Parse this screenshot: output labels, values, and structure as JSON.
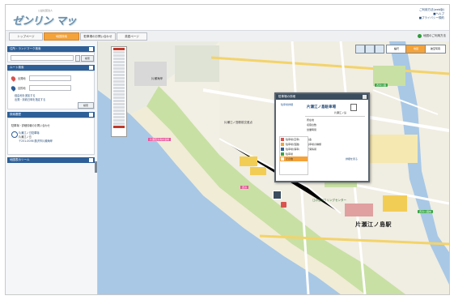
{
  "header": {
    "logo_small": "公益社団法人",
    "logo_text": "ゼンリン マップ",
    "links": [
      "ご利用方法(web版)",
      "■ヘルプ",
      "■プライバシー規約"
    ]
  },
  "tabs": [
    {
      "label": "トップページ",
      "active": false
    },
    {
      "label": "地図検索",
      "active": true
    },
    {
      "label": "駐車場のお問い合わせ",
      "active": false
    },
    {
      "label": "英語ページ",
      "active": false
    }
  ],
  "help_label": "地図のご利用方法",
  "sidebar": {
    "search_panel": {
      "title": "住所・ランドマーク検索",
      "button": "検索"
    },
    "route_panel": {
      "title": "ルート検索",
      "start_label": "出発地",
      "goal_label": "目的地",
      "link1": "経由地を追加する",
      "link2": "出発・到着日時を指定する",
      "button": "検索"
    },
    "history_panel": {
      "title": "検索履歴",
      "line1": "駐車場・詳細情報のお問い合わせ",
      "item_title": "片瀬江ノ島駐車場",
      "item_sub": "片瀬江ノ島",
      "item_line": "〒251-0036 藤沢市片瀬海岸"
    },
    "extra_panel": {
      "title": "地図表示ツール"
    }
  },
  "map": {
    "labels": {
      "area1": "片瀬海岸",
      "area2": "西浜公園",
      "area3": "片瀬江ノ島駅前交差点",
      "area4": "江の島ボウリングセンター",
      "area5": "西浜公園前",
      "station": "片瀬江ノ島駅",
      "pink1": "片瀬西浜海水浴場",
      "pink2": "西浜"
    },
    "tools": [
      "縮尺",
      "地図",
      "航空写真"
    ]
  },
  "popup": {
    "title": "駐車場の詳細",
    "brand": "駐車場詳細",
    "name": "片瀬江ノ島駐車場",
    "sub": "片瀬江ノ島",
    "rows": [
      "所在地",
      "収容台数",
      "営業時間",
      "料金",
      "駐車場の種類",
      "空満情報"
    ],
    "legend": [
      "駐車場(空車)",
      "駐車場(混雑)",
      "駐車場(満車)",
      "駐車場",
      "その他"
    ],
    "link": "詳細を見る"
  },
  "colors": {
    "tab_active": "#f4a23a",
    "panel_header": "#2e5f97",
    "sea": "#a8c8e6",
    "park": "#c8e0a4",
    "beach": "#f1ecd6"
  }
}
